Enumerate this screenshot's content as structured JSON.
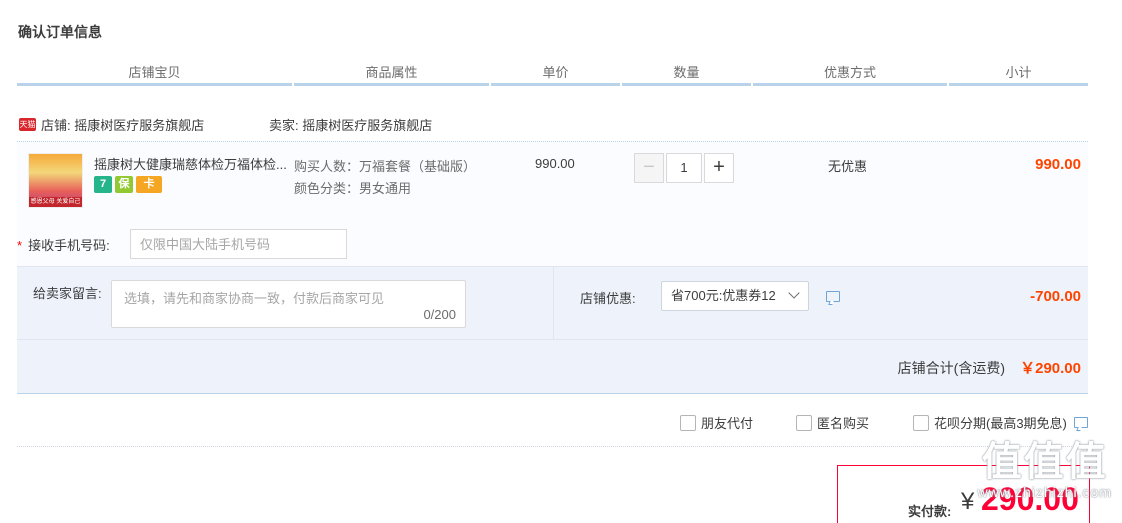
{
  "page_title": "确认订单信息",
  "table_header": [
    "店铺宝贝",
    "商品属性",
    "单价",
    "数量",
    "优惠方式",
    "小计"
  ],
  "shop": {
    "icon_text": "天猫",
    "name_label": "店铺: 摇康树医疗服务旗舰店",
    "seller_label": "卖家: 摇康树医疗服务旗舰店"
  },
  "item": {
    "thumb_band_text": "感恩父母 关爱自己",
    "title": "摇康树大健康瑞慈体检万福体检卡",
    "title_display": "摇康树大健康瑞慈体检万福体检...",
    "badges": [
      "7",
      "保",
      "卡"
    ],
    "attr_people": "购买人数：万福套餐（基础版）",
    "attr_color": "颜色分类：男女通用",
    "unit_price": "990.00",
    "quantity": "1",
    "qty_minus": "−",
    "qty_plus": "+",
    "discount_method": "无优惠",
    "subtotal": "990.00"
  },
  "phone": {
    "required_mark": "*",
    "label": "接收手机号码:",
    "placeholder": "仅限中国大陆手机号码"
  },
  "message": {
    "label": "给卖家留言:",
    "placeholder": "选填，请先和商家协商一致，付款后商家可见",
    "count": "0/200"
  },
  "coupon": {
    "label": "店铺优惠:",
    "selected": "省700元:优惠券12",
    "amount": "-700.00"
  },
  "shop_total": {
    "label": "店铺合计(含运费)",
    "value": "￥290.00"
  },
  "options": [
    "朋友代付",
    "匿名购买",
    "花呗分期(最高3期免息)"
  ],
  "payment": {
    "label": "实付款:",
    "currency": "¥",
    "value": "290.00"
  },
  "watermark": {
    "big": "值值值",
    "small": "www.zhizhizhi.com"
  },
  "colors": {
    "accent_price": "#ff4400",
    "pay_border": "#ff0036",
    "header_underline": "#b9d3ea",
    "message_bg": "#eef3fb"
  }
}
